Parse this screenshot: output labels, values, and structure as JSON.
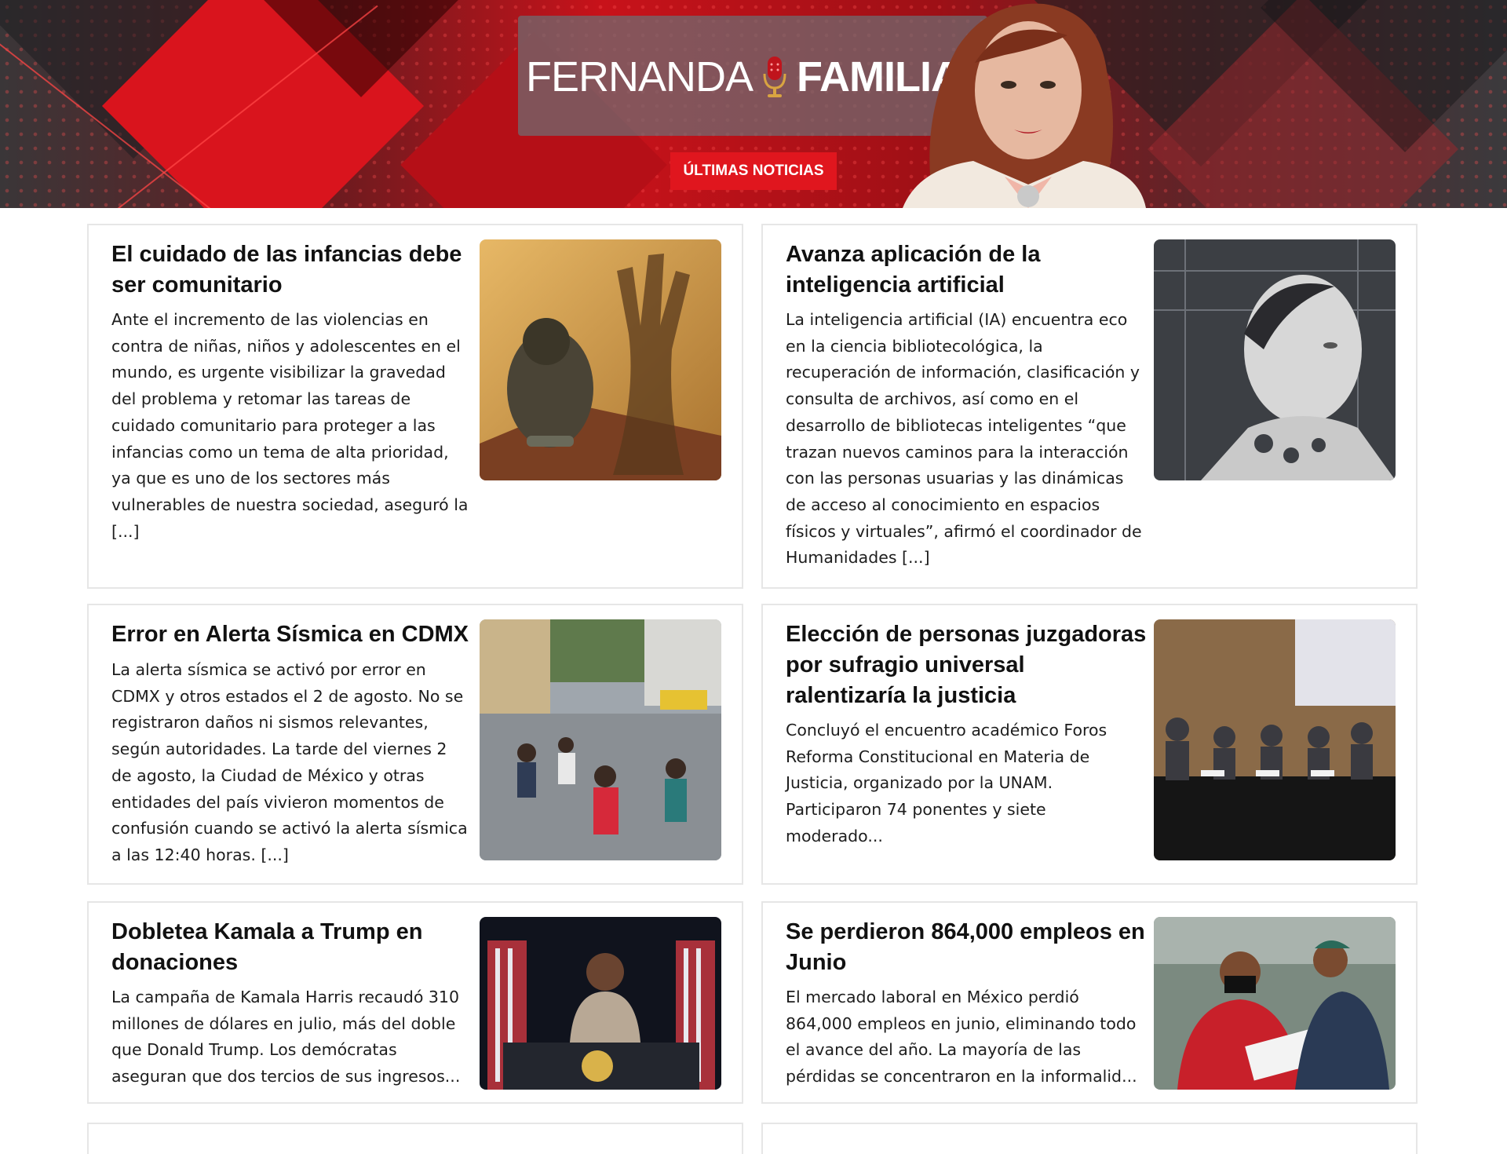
{
  "header": {
    "logo_word1": "FERNANDA",
    "logo_word2": "FAMILIAR",
    "logo_icon": "microphone-icon",
    "cta_label": "ÚLTIMAS NOTICIAS",
    "accent_color": "#e0161e"
  },
  "articles": [
    {
      "title": "El cuidado de las infancias debe ser comunitario",
      "excerpt": "Ante el incremento de las violencias en contra de niñas, niños y adolescentes en el mundo, es urgente visibilizar la gravedad del problema y retomar las tareas de cuidado comunitario para proteger a las infancias como un tema de alta prioridad, ya que es uno de los sectores más vulnerables de nuestra sociedad, aseguró la [...]"
    },
    {
      "title": "Avanza aplicación de la inteligencia artificial",
      "excerpt": "La inteligencia artificial (IA) encuentra eco en la ciencia bibliotecológica, la recuperación de información, clasificación y consulta de archivos, así como en el desarrollo de bibliotecas inteligentes “que trazan nuevos caminos para la interacción con las personas usuarias y las dinámicas de acceso al conocimiento en espacios físicos y virtuales”, afirmó el coordinador de Humanidades [...]"
    },
    {
      "title": "Error en Alerta Sísmica en CDMX",
      "excerpt": "La alerta sísmica se activó por error en CDMX y otros estados el 2 de agosto. No se registraron daños ni sismos relevantes, según autoridades. La tarde del viernes 2 de agosto, la Ciudad de México y otras entidades del país vivieron momentos de confusión cuando se activó la alerta sísmica a las 12:40 horas. [...]"
    },
    {
      "title": "Elección de personas juzgadoras por sufragio universal ralentizaría la justicia",
      "excerpt": "Concluyó el encuentro académico Foros Reforma Constitucional en Materia de Justicia, organizado por la UNAM. Participaron 74 ponentes y siete moderado..."
    },
    {
      "title": "Dobletea Kamala a Trump en donaciones",
      "excerpt": "La campaña de Kamala Harris recaudó 310 millones de dólares en julio, más del doble que Donald Trump. Los demócratas aseguran que dos tercios de sus ingresos..."
    },
    {
      "title": "Se perdieron 864,000 empleos en Junio",
      "excerpt": "El mercado laboral en México perdió 864,000 empleos en junio, eliminando todo el avance del año. La mayoría de las pérdidas se concentraron en la informalid..."
    }
  ]
}
